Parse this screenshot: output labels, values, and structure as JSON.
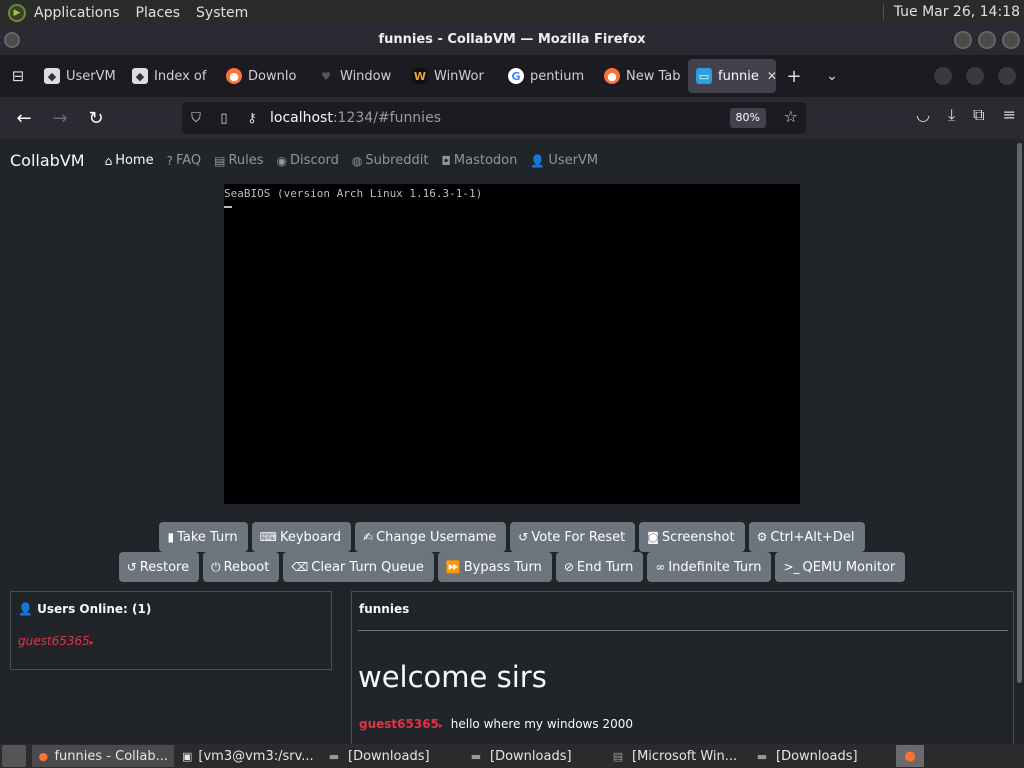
{
  "desktop_panel": {
    "menus": [
      "Applications",
      "Places",
      "System"
    ],
    "clock": "Tue Mar 26, 14:18"
  },
  "window": {
    "title": "funnies - CollabVM — Mozilla Firefox"
  },
  "tabs": [
    {
      "label": "UserVM",
      "icon": "uservm-icon"
    },
    {
      "label": "Index of",
      "icon": "uservm-icon"
    },
    {
      "label": "Downlo",
      "icon": "firefox-icon"
    },
    {
      "label": "Window",
      "icon": "heart-icon"
    },
    {
      "label": "WinWor",
      "icon": "winworld-icon"
    },
    {
      "label": "pentium",
      "icon": "google-icon"
    },
    {
      "label": "New Tab",
      "icon": "firefox-icon"
    },
    {
      "label": "funnie",
      "icon": "monitor-icon",
      "active": true
    }
  ],
  "urlbar": {
    "host": "localhost",
    "path": ":1234/#funnies",
    "zoom": "80%"
  },
  "site_nav": {
    "brand": "CollabVM",
    "items": [
      "Home",
      "FAQ",
      "Rules",
      "Discord",
      "Subreddit",
      "Mastodon",
      "UserVM"
    ]
  },
  "vm_screen": {
    "bios_text": "SeaBIOS (version Arch Linux 1.16.3-1-1)"
  },
  "vm_buttons_row1": [
    "Take Turn",
    "Keyboard",
    "Change Username",
    "Vote For Reset",
    "Screenshot",
    "Ctrl+Alt+Del"
  ],
  "vm_buttons_row2": [
    "Restore",
    "Reboot",
    "Clear Turn Queue",
    "Bypass Turn",
    "End Turn",
    "Indefinite Turn",
    "QEMU Monitor"
  ],
  "users_panel": {
    "heading": "Users Online: (1)",
    "users": [
      "guest65365"
    ]
  },
  "chat_panel": {
    "title": "funnies",
    "welcome": "welcome sirs",
    "messages": [
      {
        "user": "guest65365",
        "text": "hello where my windows 2000"
      }
    ]
  },
  "taskbar": {
    "items": [
      "funnies - Collab...",
      "[vm3@vm3:/srv...",
      "[Downloads]",
      "[Downloads]",
      "[Microsoft Win...",
      "[Downloads]"
    ]
  },
  "colors": {
    "page_bg": "#212529",
    "button_bg": "#6c757d",
    "username_red": "#dc3545"
  }
}
